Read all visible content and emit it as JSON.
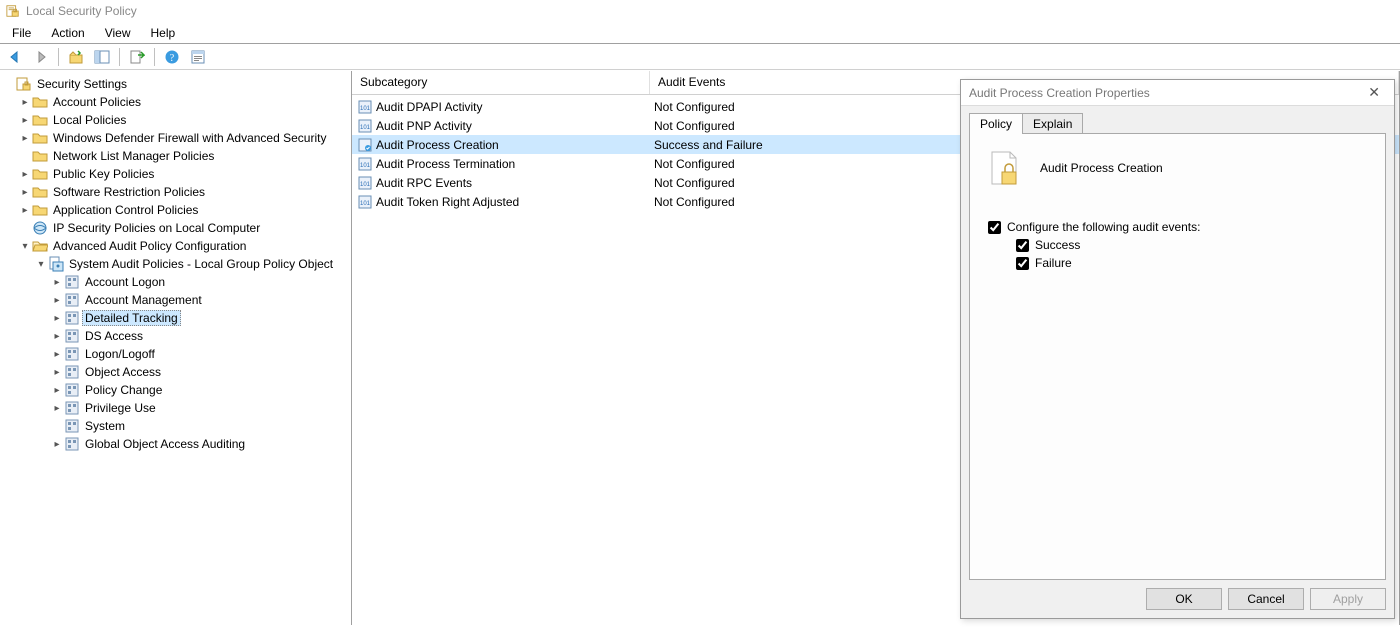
{
  "window": {
    "title": "Local Security Policy"
  },
  "menu": {
    "file": "File",
    "action": "Action",
    "view": "View",
    "help": "Help"
  },
  "tree": {
    "root": "Security Settings",
    "account_policies": "Account Policies",
    "local_policies": "Local Policies",
    "wf": "Windows Defender Firewall with Advanced Security",
    "nlm": "Network List Manager Policies",
    "pkp": "Public Key Policies",
    "srp": "Software Restriction Policies",
    "acp": "Application Control Policies",
    "ipsec": "IP Security Policies on Local Computer",
    "aapc": "Advanced Audit Policy Configuration",
    "sap": "System Audit Policies - Local Group Policy Object",
    "cats": {
      "account_logon": "Account Logon",
      "account_mgmt": "Account Management",
      "detailed_tracking": "Detailed Tracking",
      "ds_access": "DS Access",
      "logon": "Logon/Logoff",
      "object_access": "Object Access",
      "policy_change": "Policy Change",
      "privilege_use": "Privilege Use",
      "system": "System",
      "goaa": "Global Object Access Auditing"
    }
  },
  "list": {
    "header_subcategory": "Subcategory",
    "header_audit_events": "Audit Events",
    "rows": [
      {
        "name": "Audit DPAPI Activity",
        "events": "Not Configured"
      },
      {
        "name": "Audit PNP Activity",
        "events": "Not Configured"
      },
      {
        "name": "Audit Process Creation",
        "events": "Success and Failure"
      },
      {
        "name": "Audit Process Termination",
        "events": "Not Configured"
      },
      {
        "name": "Audit RPC Events",
        "events": "Not Configured"
      },
      {
        "name": "Audit Token Right Adjusted",
        "events": "Not Configured"
      }
    ]
  },
  "dialog": {
    "title": "Audit Process Creation Properties",
    "tab_policy": "Policy",
    "tab_explain": "Explain",
    "heading": "Audit Process Creation",
    "configure_label": "Configure the following audit events:",
    "success_label": "Success",
    "failure_label": "Failure",
    "configure_checked": true,
    "success_checked": true,
    "failure_checked": true,
    "ok": "OK",
    "cancel": "Cancel",
    "apply": "Apply"
  }
}
